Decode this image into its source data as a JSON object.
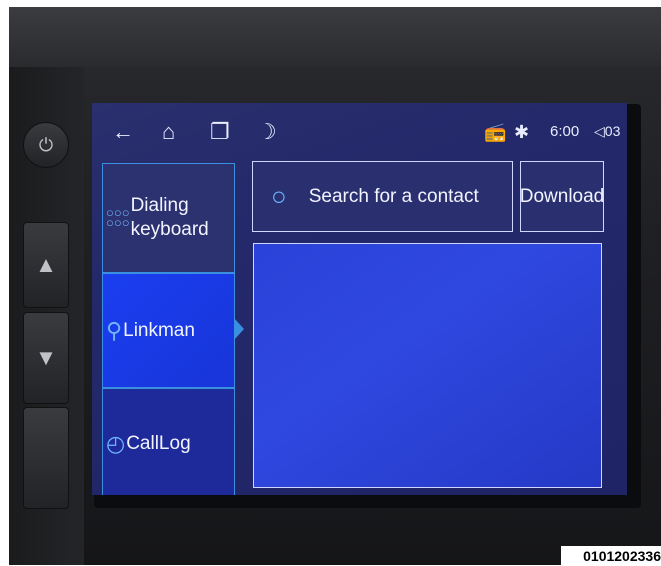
{
  "status_bar": {
    "icons": [
      "back-icon",
      "home-icon",
      "recent-apps-icon",
      "night-mode-icon",
      "radio-icon",
      "bluetooth-icon",
      "volume-icon"
    ],
    "time": "6:00",
    "volume": "03"
  },
  "sidebar": {
    "items": [
      {
        "label_line1": "Dialing",
        "label_line2": "keyboard",
        "icon": "keypad-icon"
      },
      {
        "label": "Linkman",
        "icon": "contact-icon"
      },
      {
        "label": "CallLog",
        "icon": "clock-icon"
      }
    ]
  },
  "search": {
    "placeholder": "Search for a contact"
  },
  "download_label": "Download",
  "caption": "0101202336",
  "colors": {
    "accent": "#3a90e0",
    "selected": "#1a3ef0",
    "screen_bg": "#23296a"
  }
}
